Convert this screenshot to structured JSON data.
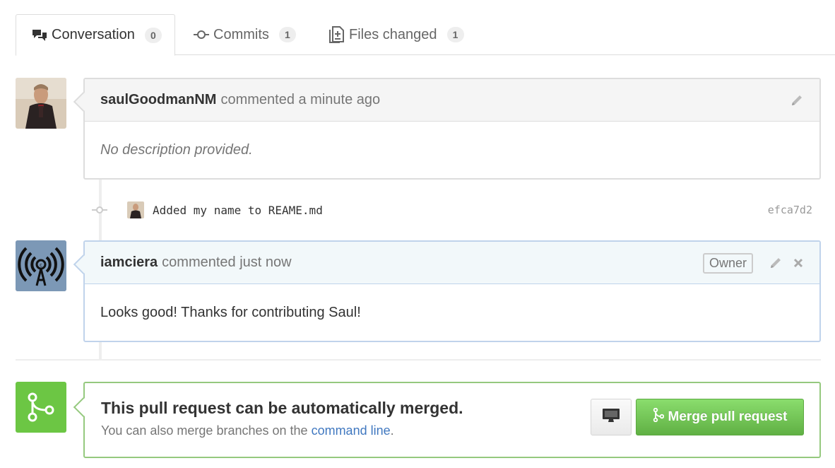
{
  "tabs": [
    {
      "label": "Conversation",
      "count": "0",
      "icon": "comment-discussion-icon"
    },
    {
      "label": "Commits",
      "count": "1",
      "icon": "git-commit-icon"
    },
    {
      "label": "Files changed",
      "count": "1",
      "icon": "diff-icon"
    }
  ],
  "comments": [
    {
      "author": "saulGoodmanNM",
      "meta": "commented a minute ago",
      "body": "No description provided."
    },
    {
      "author": "iamciera",
      "meta": "commented just now",
      "badge": "Owner",
      "body": "Looks good! Thanks for contributing Saul!"
    }
  ],
  "commit": {
    "message": "Added my name to REAME.md",
    "sha": "efca7d2"
  },
  "merge": {
    "title": "This pull request can be automatically merged.",
    "sub_prefix": "You can also merge branches on the",
    "sub_link": "command line",
    "sub_suffix": ".",
    "button_label": "Merge pull request"
  },
  "colors": {
    "merge_green": "#6cc644",
    "link_blue": "#4078c0",
    "owner_border": "#c0d3eb"
  }
}
